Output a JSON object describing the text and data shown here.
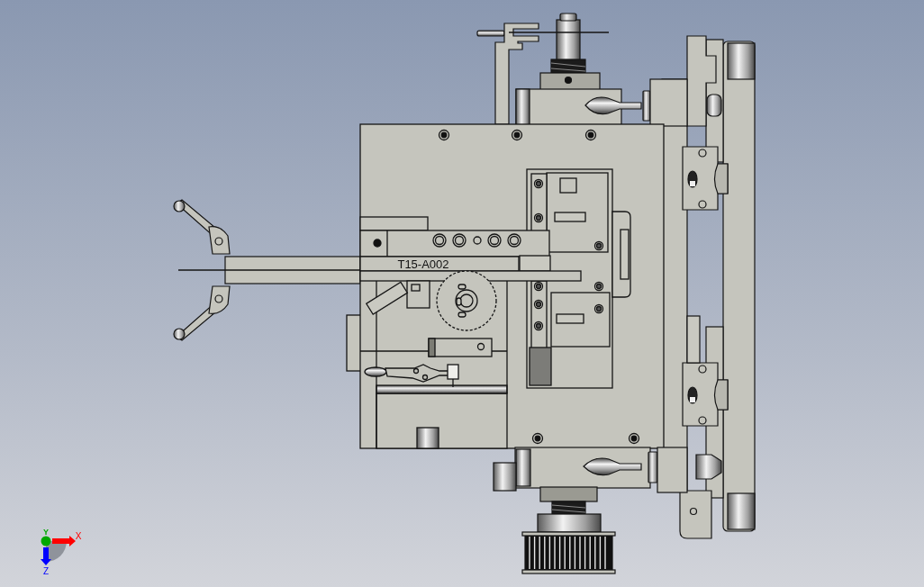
{
  "part_label": "T15-A002",
  "axes": [
    {
      "label": "X",
      "color": "#ff0000"
    },
    {
      "label": "Y",
      "color": "#00a800"
    },
    {
      "label": "Z",
      "color": "#0000ff"
    }
  ]
}
